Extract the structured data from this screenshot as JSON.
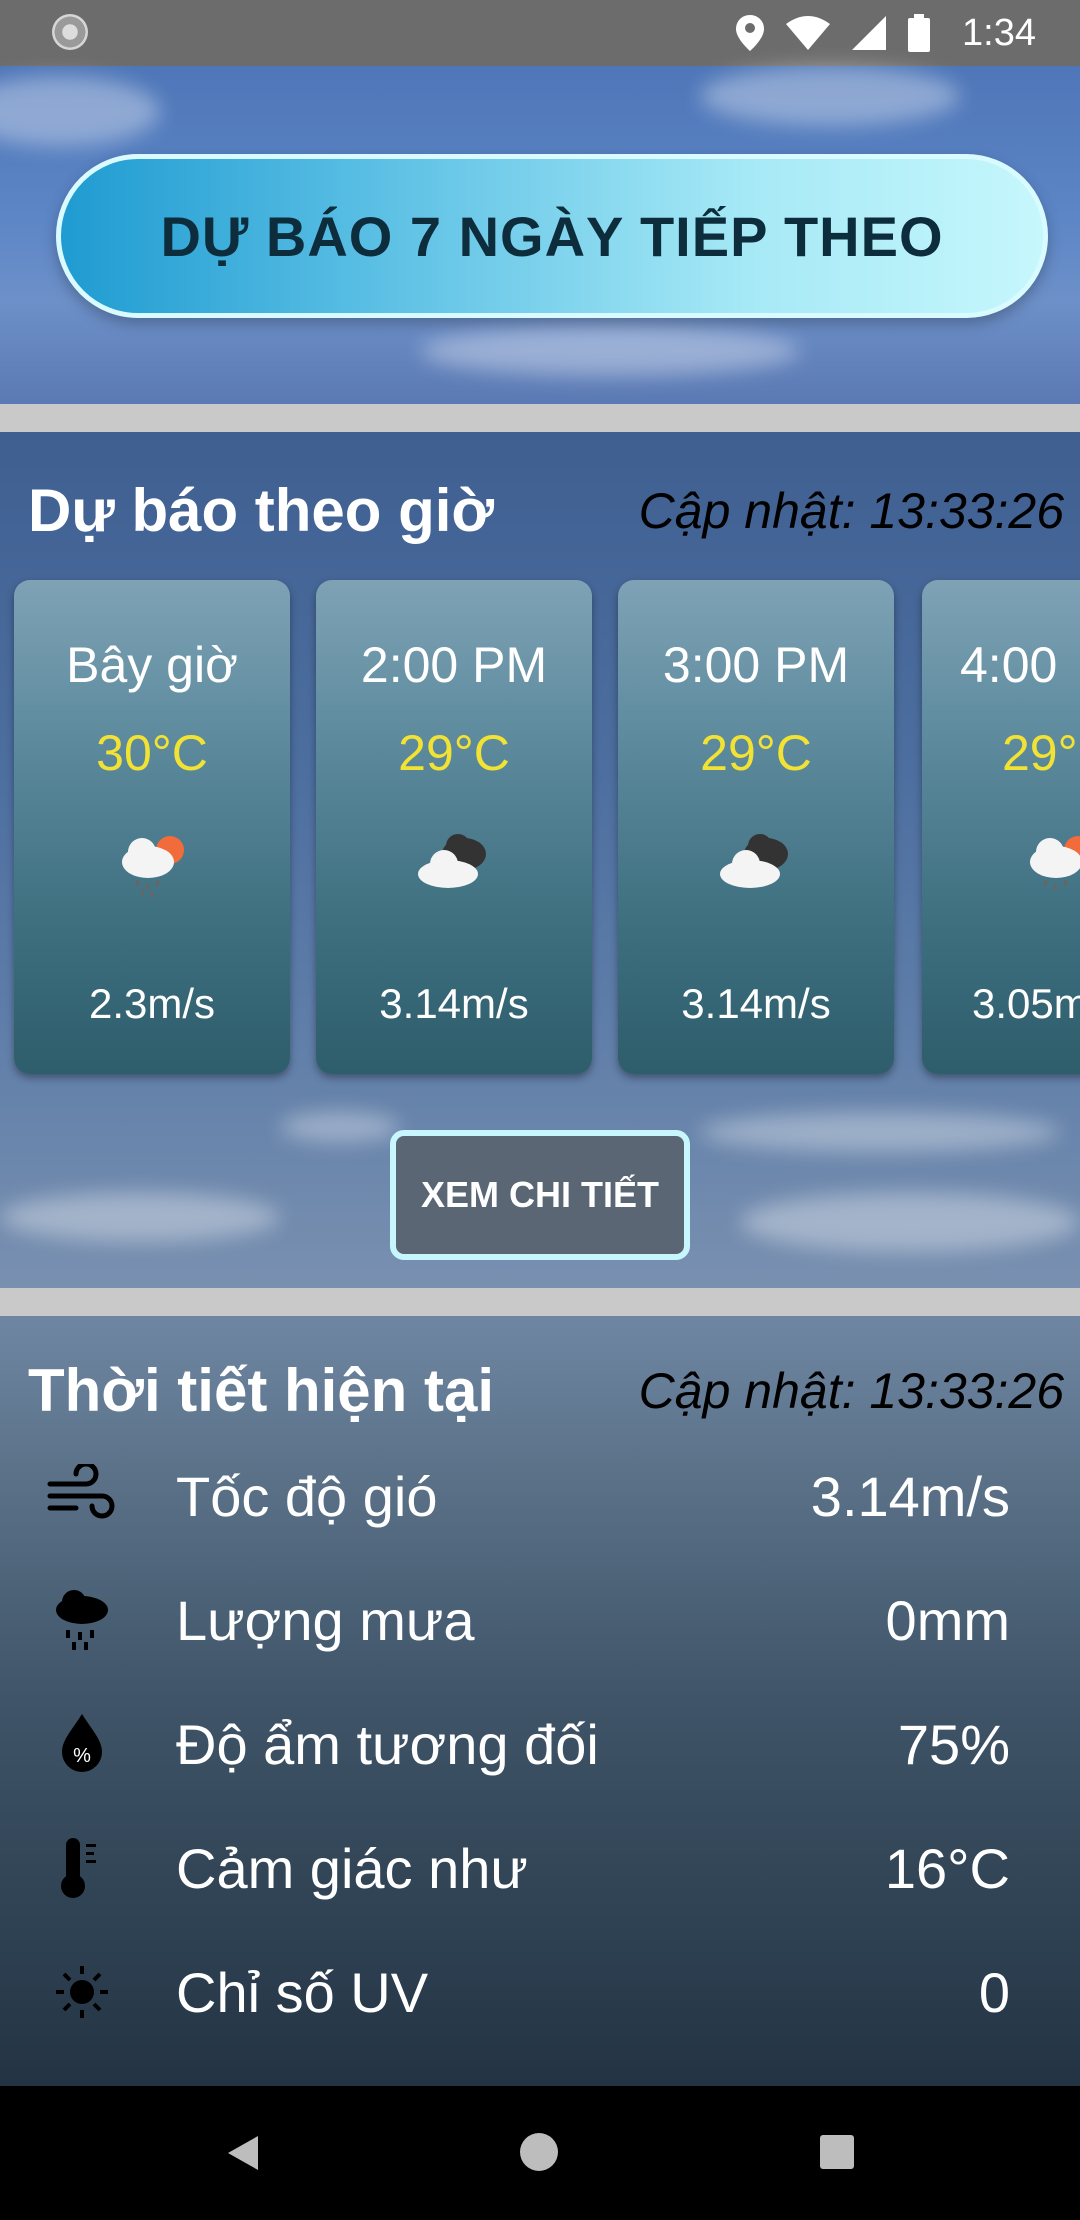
{
  "status_bar": {
    "time": "1:34",
    "icons": [
      "sync-icon",
      "location-icon",
      "wifi-icon",
      "signal-icon",
      "battery-icon"
    ]
  },
  "seven_day_button": {
    "label": "DỰ BÁO 7 NGÀY TIẾP THEO"
  },
  "hourly": {
    "title": "Dự báo theo giờ",
    "updated": "Cập nhật: 13:33:26",
    "cards": [
      {
        "time": "Bây giờ",
        "temp": "30°C",
        "icon": "rain-sun-icon",
        "wind": "2.3m/s"
      },
      {
        "time": "2:00 PM",
        "temp": "29°C",
        "icon": "cloudy-icon",
        "wind": "3.14m/s"
      },
      {
        "time": "3:00 PM",
        "temp": "29°C",
        "icon": "cloudy-icon",
        "wind": "3.14m/s"
      },
      {
        "time": "4:00",
        "temp": "29°",
        "icon": "rain-sun-icon",
        "wind": "3.05m"
      }
    ],
    "detail_button": "XEM CHI TIẾT"
  },
  "current": {
    "title": "Thời tiết hiện tại",
    "updated": "Cập nhật: 13:33:26",
    "rows": [
      {
        "icon": "wind-icon",
        "label": "Tốc độ gió",
        "value": "3.14m/s"
      },
      {
        "icon": "rain-cloud-icon",
        "label": "Lượng mưa",
        "value": "0mm"
      },
      {
        "icon": "humidity-drop-icon",
        "label": "Độ ẩm tương đối",
        "value": "75%"
      },
      {
        "icon": "thermometer-icon",
        "label": "Cảm giác như",
        "value": "16°C"
      },
      {
        "icon": "uv-sun-icon",
        "label": "Chỉ số UV",
        "value": "0"
      }
    ]
  },
  "colors": {
    "temperature": "#f2e233",
    "button_gradient_start": "#1f9bd1",
    "button_gradient_end": "#c6f7fc"
  }
}
